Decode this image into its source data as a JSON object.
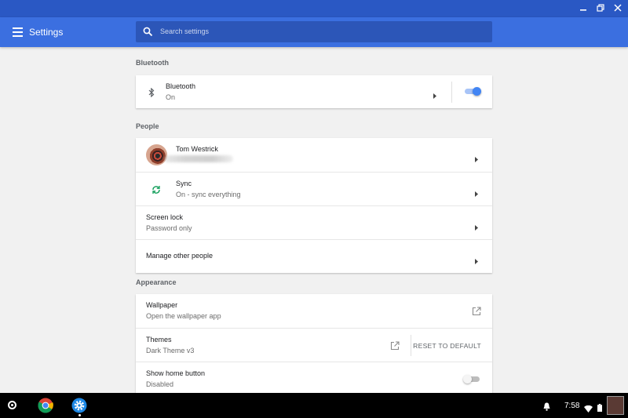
{
  "header": {
    "menu_icon": "hamburger-menu-icon",
    "title": "Settings",
    "search_placeholder": "Search settings"
  },
  "window_controls": [
    "minimize-icon",
    "restore-icon",
    "close-icon"
  ],
  "bluetooth": {
    "section_title": "Bluetooth",
    "row": {
      "icon": "bluetooth-icon",
      "title": "Bluetooth",
      "subtitle": "On",
      "toggle_on": true
    }
  },
  "people": {
    "section_title": "People",
    "account": {
      "name": "Tom Westrick"
    },
    "sync": {
      "icon": "sync-icon",
      "title": "Sync",
      "subtitle": "On - sync everything"
    },
    "screen_lock": {
      "title": "Screen lock",
      "subtitle": "Password only"
    },
    "manage": {
      "title": "Manage other people"
    }
  },
  "appearance": {
    "section_title": "Appearance",
    "wallpaper": {
      "title": "Wallpaper",
      "subtitle": "Open the wallpaper app",
      "icon": "open-external-icon"
    },
    "themes": {
      "title": "Themes",
      "subtitle": "Dark Theme v3",
      "icon": "open-external-icon",
      "reset_label": "RESET TO DEFAULT"
    },
    "home_button": {
      "title": "Show home button",
      "subtitle": "Disabled",
      "toggle_on": false
    }
  },
  "shelf": {
    "apps": [
      "launcher-icon",
      "chrome-icon",
      "settings-icon"
    ],
    "clock": "7:58",
    "tray_icons": [
      "notification-bell-icon",
      "wifi-icon",
      "battery-icon"
    ]
  },
  "colors": {
    "titlebar": "#2a58c4",
    "header": "#3b6fe0",
    "toggle_on": "#4285f4",
    "sync_green": "#0f9d58"
  }
}
